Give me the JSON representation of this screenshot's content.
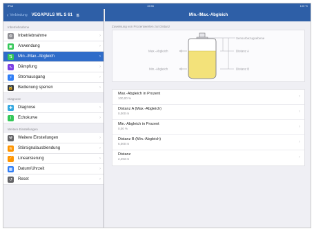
{
  "status_bar": {
    "left": "iPad",
    "center": "15:56",
    "right": "100 %"
  },
  "sidebar": {
    "back_label": "Verbindung",
    "device": "VEGAPULS WL S 61",
    "sections": [
      {
        "title": "Inbetriebnahme",
        "items": [
          {
            "label": "Inbetriebnahme",
            "icon": "gear-icon",
            "color": "#8e8e93"
          },
          {
            "label": "Anwendung",
            "icon": "application-icon",
            "color": "#34c759"
          },
          {
            "label": "Min.-/Max.-Abgleich",
            "icon": "adjustment-icon",
            "color": "#34c759",
            "selected": true
          },
          {
            "label": "Dämpfung",
            "icon": "damping-icon",
            "color": "#7b3fe4"
          },
          {
            "label": "Stromausgang",
            "icon": "current-output-icon",
            "color": "#2f7df6"
          },
          {
            "label": "Bedienung sperren",
            "icon": "lock-icon",
            "color": "#3a3a3c"
          }
        ]
      },
      {
        "title": "Diagnose",
        "items": [
          {
            "label": "Diagnose",
            "icon": "diagnosis-icon",
            "color": "#34a8e0"
          },
          {
            "label": "Echokurve",
            "icon": "echo-curve-icon",
            "color": "#34c759"
          }
        ]
      },
      {
        "title": "Weitere Einstellungen",
        "items": [
          {
            "label": "Weitere Einstellungen",
            "icon": "wrench-icon",
            "color": "#636366"
          },
          {
            "label": "Störsignalausblendung",
            "icon": "interference-icon",
            "color": "#ff9500"
          },
          {
            "label": "Linearisierung",
            "icon": "linearization-icon",
            "color": "#ff9500"
          },
          {
            "label": "Datum/Uhrzeit",
            "icon": "calendar-icon",
            "color": "#2f7df6"
          },
          {
            "label": "Reset",
            "icon": "reset-icon",
            "color": "#636366"
          }
        ]
      }
    ]
  },
  "main": {
    "title": "Min.-/Max.-Abgleich",
    "caption": "Zuweisung von Prozentwerten zur Distanz",
    "diagram": {
      "sensor_reference_plane": "Sensorbezugsebene",
      "max_adjustment": "Max.-Abgleich",
      "min_adjustment": "Min.-Abgleich",
      "distance_a": "Distanz A",
      "distance_b": "Distanz B"
    },
    "rows": [
      {
        "title": "Max.-Abgleich in Prozent",
        "value": "100,00 %"
      },
      {
        "title": "Distanz A (Max.-Abgleich)",
        "value": "0,000 m"
      },
      {
        "title": "Min.-Abgleich in Prozent",
        "value": "0,00 %"
      },
      {
        "title": "Distanz B (Min.-Abgleich)",
        "value": "6,000 m"
      },
      {
        "title": "Distanz",
        "value": "2,493 m"
      }
    ]
  },
  "colors": {
    "nav_blue": "#2e5fa7",
    "selected_blue": "#2f6cc9",
    "tank_fill": "#f3e27a"
  }
}
